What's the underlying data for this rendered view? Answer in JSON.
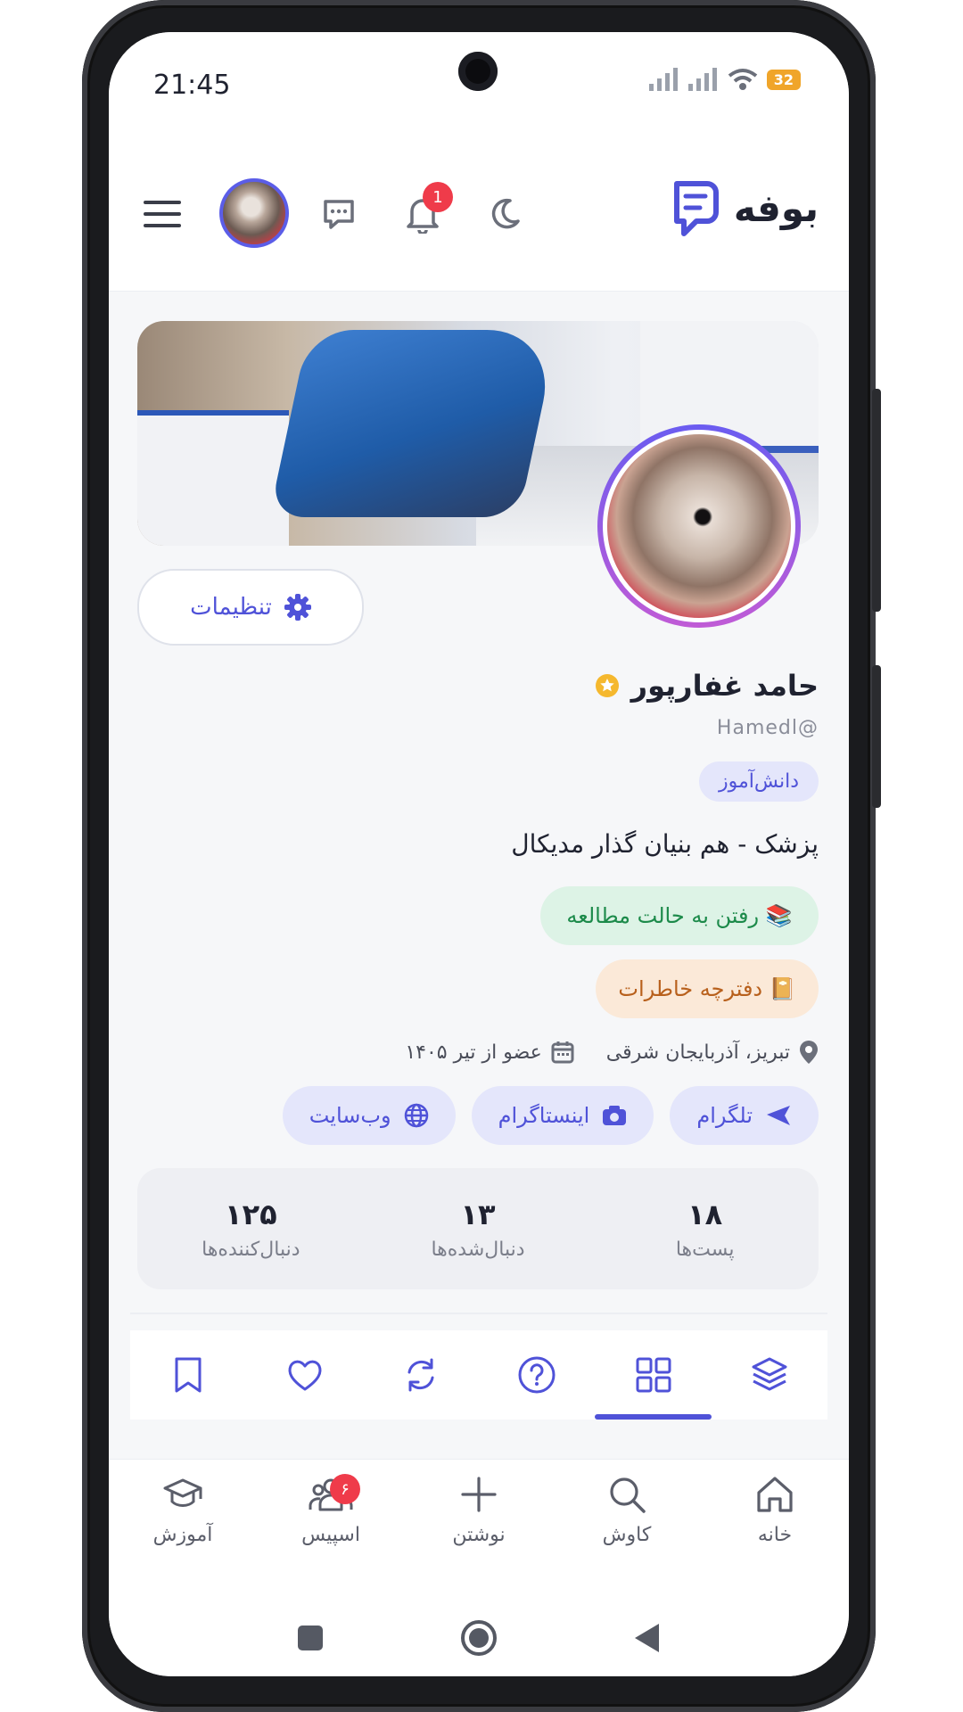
{
  "status_bar": {
    "time": "21:45",
    "battery": "32"
  },
  "header": {
    "brand_name": "بوفه",
    "notification_count": "1"
  },
  "profile": {
    "settings_label": "تنظیمات",
    "name": "حامد غفارپور",
    "handle": "Hamedl@",
    "role": "دانش‌آموز",
    "bio": "پزشک - هم بنیان گذار مدیکال",
    "study_mode": "📚 رفتن به حالت مطالعه",
    "journal": "📔 دفترچه خاطرات",
    "location": "تبریز، آذربایجان شرقی",
    "member_since": "عضو از تیر ۱۴۰۵",
    "links": [
      {
        "label": "تلگرام",
        "icon": "send-icon"
      },
      {
        "label": "اینستاگرام",
        "icon": "camera-icon"
      },
      {
        "label": "وب‌سایت",
        "icon": "globe-icon"
      }
    ],
    "stats": [
      {
        "value": "۱۸",
        "label": "پست‌ها"
      },
      {
        "value": "۱۳",
        "label": "دنبال‌شده‌ها"
      },
      {
        "value": "۱۲۵",
        "label": "دنبال‌کننده‌ها"
      }
    ]
  },
  "tabs": [
    {
      "icon": "layers-icon",
      "active": false
    },
    {
      "icon": "grid-icon",
      "active": true
    },
    {
      "icon": "question-icon",
      "active": false
    },
    {
      "icon": "repost-icon",
      "active": false
    },
    {
      "icon": "heart-icon",
      "active": false
    },
    {
      "icon": "bookmark-icon",
      "active": false
    }
  ],
  "bottom_nav": {
    "items": [
      {
        "label": "خانه",
        "icon": "home-icon"
      },
      {
        "label": "کاوش",
        "icon": "search-icon"
      },
      {
        "label": "نوشتن",
        "icon": "plus-icon"
      },
      {
        "label": "اسپیس",
        "icon": "people-icon",
        "badge": "۶"
      },
      {
        "label": "آموزش",
        "icon": "graduation-cap-icon"
      }
    ]
  },
  "colors": {
    "accent": "#4f52d8",
    "badge": "#ef3b4a",
    "study_bg": "#ddf3e6",
    "journal_bg": "#fbe9d8"
  }
}
